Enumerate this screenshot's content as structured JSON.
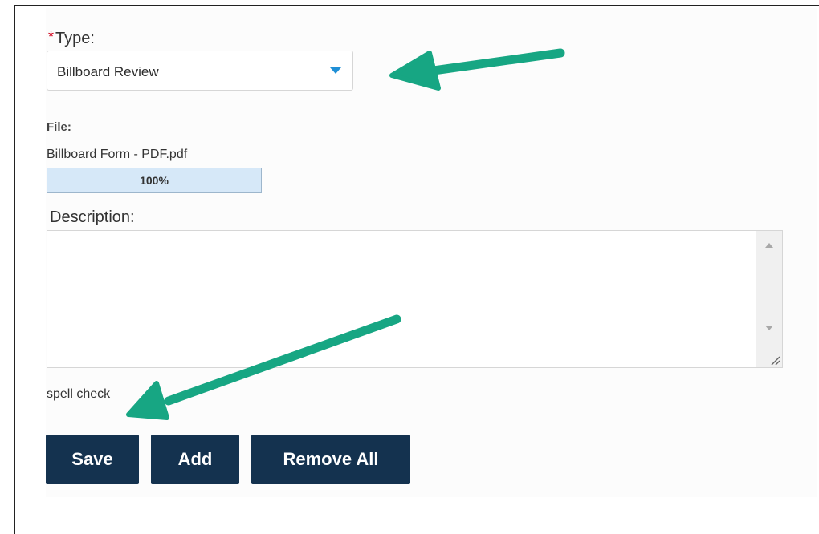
{
  "form": {
    "type_required_mark": "*",
    "type_label": "Type:",
    "type_value": "Billboard Review",
    "file_label": "File:",
    "file_name": "Billboard Form - PDF.pdf",
    "upload_progress_text": "100%",
    "upload_progress_fraction": 1.0,
    "description_label": "Description:",
    "description_value": "",
    "spell_check_label": "spell check"
  },
  "buttons": {
    "save_label": "Save",
    "add_label": "Add",
    "remove_all_label": "Remove All"
  },
  "colors": {
    "button_bg": "#14324f",
    "annotation_arrow": "#17a683",
    "dropdown_caret": "#1f8fd6",
    "required_mark": "#d0021b",
    "progress_fill": "#d6e8f8"
  },
  "annotations": [
    {
      "icon": "arrow-icon",
      "points_to": "type-select"
    },
    {
      "icon": "arrow-icon",
      "points_to": "spell-check-link"
    }
  ]
}
